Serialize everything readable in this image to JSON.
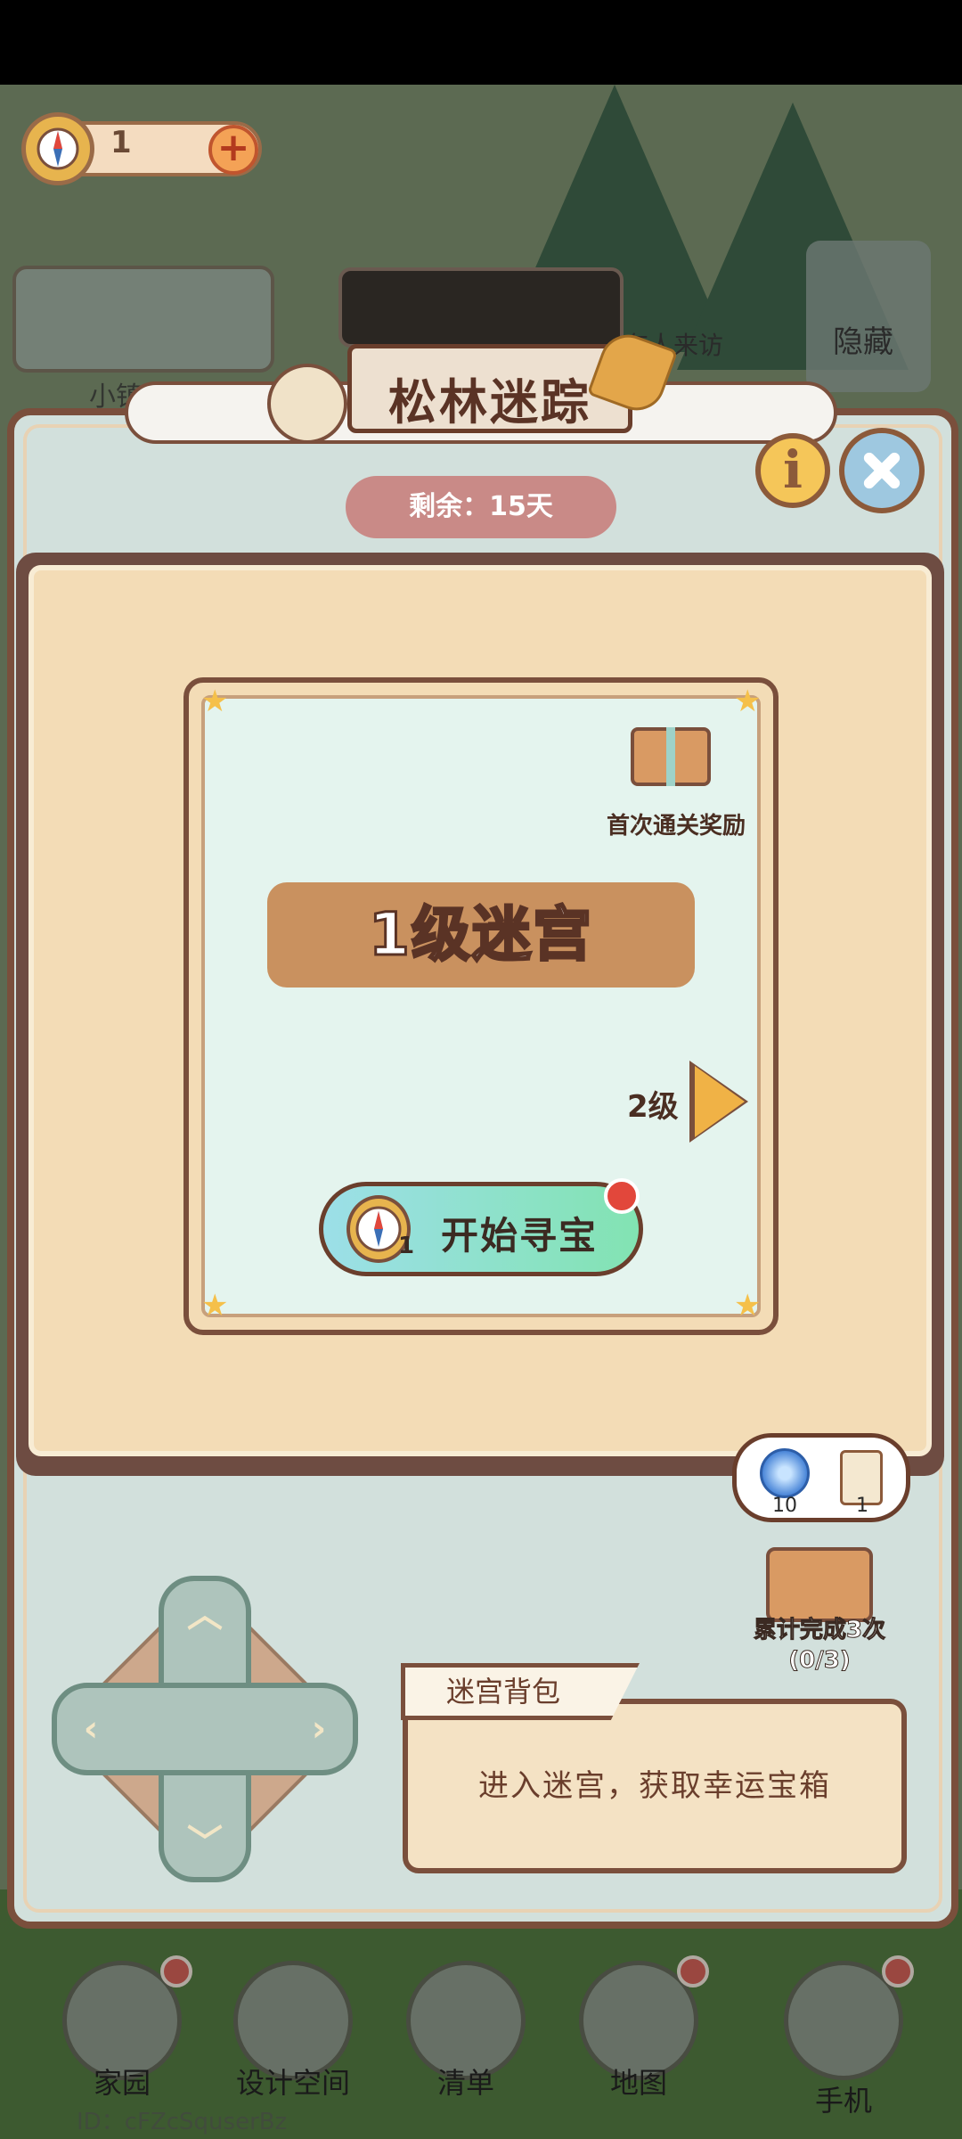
{
  "hud": {
    "compass_count": "1",
    "plus": "+"
  },
  "background": {
    "news_label": "小镇快讯",
    "visit_label": "有人来访",
    "hide_label": "隐藏"
  },
  "title": "松林迷踪",
  "remaining": "剩余：15天",
  "maze": {
    "first_clear_reward": "首次通关奖励",
    "level_title": "1级迷宫",
    "next_level": "2级",
    "start_button": "开始寻宝",
    "start_cost": "1"
  },
  "cumulative": {
    "swirl_count": "10",
    "scroll_count": "1",
    "label_line1": "累计完成3次",
    "label_line2": "(0/3)"
  },
  "backpack": {
    "tab_label": "迷宫背包",
    "message": "进入迷宫，获取幸运宝箱"
  },
  "bottom_nav": [
    {
      "label": "家园",
      "icon": "house-icon"
    },
    {
      "label": "设计空间",
      "icon": "design-icon"
    },
    {
      "label": "清单",
      "icon": "checklist-icon"
    },
    {
      "label": "地图",
      "icon": "map-pin-icon"
    },
    {
      "label": "手机",
      "icon": "phone-icon"
    }
  ],
  "id_text": "ID：cFZcSquserBz",
  "colors": {
    "modal_bg": "#d2e0dc",
    "panel_brown": "#6e4c42",
    "level_title_bg": "#c9915f",
    "start_gradient_start": "#9cdfe8",
    "start_gradient_end": "#82e3b2",
    "remaining_pill": "#c98a87"
  }
}
